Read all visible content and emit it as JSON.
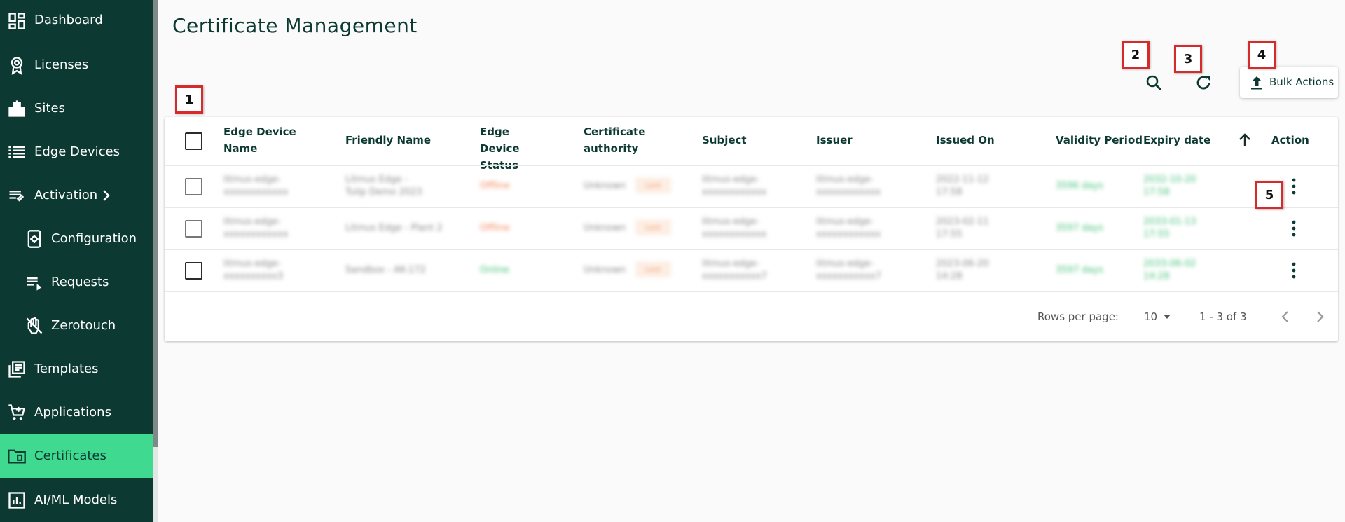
{
  "sidebar": {
    "items": [
      {
        "label": "Dashboard",
        "icon": "dashboard-icon"
      },
      {
        "label": "Licenses",
        "icon": "license-icon"
      },
      {
        "label": "Sites",
        "icon": "sites-icon"
      },
      {
        "label": "Edge Devices",
        "icon": "edge-devices-icon"
      },
      {
        "label": "Activation",
        "icon": "activation-icon"
      },
      {
        "label": "Configuration",
        "icon": "configuration-icon"
      },
      {
        "label": "Requests",
        "icon": "requests-icon"
      },
      {
        "label": "Zerotouch",
        "icon": "zerotouch-icon"
      },
      {
        "label": "Templates",
        "icon": "templates-icon"
      },
      {
        "label": "Applications",
        "icon": "applications-icon"
      },
      {
        "label": "Certificates",
        "icon": "certificates-icon",
        "active": true
      },
      {
        "label": "AI/ML Models",
        "icon": "aiml-models-icon"
      }
    ]
  },
  "header": {
    "title": "Certificate Management"
  },
  "toolbar": {
    "bulk_actions_label": "Bulk Actions"
  },
  "callouts": [
    "1",
    "2",
    "3",
    "4",
    "5"
  ],
  "table": {
    "columns": [
      "Edge Device Name",
      "Friendly Name",
      "Edge Device Status",
      "Certificate authority",
      "Subject",
      "Issuer",
      "Issued On",
      "Validity Period",
      "Expiry date",
      "Action"
    ],
    "rows": [
      {
        "device": "litmus-edge-xxxxxxxxxxxx",
        "friendly": "Litmus Edge - Tulip Demo 2023",
        "status": "Offline",
        "ca": "Unknown",
        "ca_badge": "Lest",
        "subject": "litmus-edge-xxxxxxxxxxxx",
        "issuer": "litmus-edge-xxxxxxxxxxxx",
        "issued": "2022-11-12 17:58",
        "validity": "3596 days",
        "expiry": "2032-10-20 17:58"
      },
      {
        "device": "litmus-edge-xxxxxxxxxxxx",
        "friendly": "Litmus Edge - Plant 2",
        "status": "Offline",
        "ca": "Unknown",
        "ca_badge": "Lest",
        "subject": "litmus-edge-xxxxxxxxxxxx",
        "issuer": "litmus-edge-xxxxxxxxxxxx",
        "issued": "2023-02-11 17:55",
        "validity": "3597 days",
        "expiry": "2033-01-13 17:55"
      },
      {
        "device": "litmus-edge-xxxxxxxxxx3",
        "friendly": "Sandbox - AK-172",
        "status": "Online",
        "ca": "Unknown",
        "ca_badge": "Lest",
        "subject": "litmus-edge-xxxxxxxxxxx7",
        "issuer": "litmus-edge-xxxxxxxxxxx7",
        "issued": "2023-06-20 14:28",
        "validity": "3597 days",
        "expiry": "2033-06-02 14:28"
      }
    ]
  },
  "footer": {
    "rows_per_page_label": "Rows per page:",
    "rows_per_page_value": "10",
    "range_label": "1 - 3 of 3"
  }
}
